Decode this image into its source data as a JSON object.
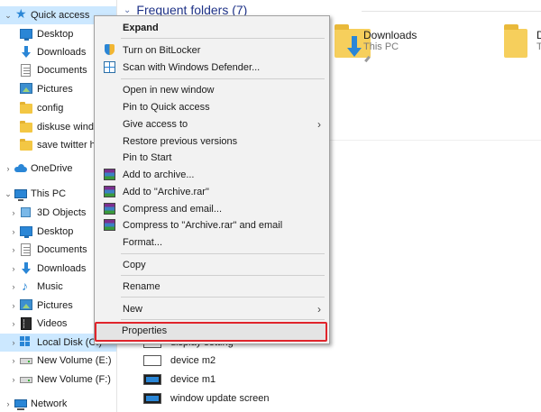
{
  "nav": {
    "quick_access": "Quick access",
    "qa_items": [
      "Desktop",
      "Downloads",
      "Documents",
      "Pictures",
      "config",
      "diskuse windo",
      "save twitter ho"
    ],
    "onedrive": "OneDrive",
    "this_pc": "This PC",
    "pc_items": [
      "3D Objects",
      "Desktop",
      "Documents",
      "Downloads",
      "Music",
      "Pictures",
      "Videos",
      "Local Disk (C:)",
      "New Volume (E:)",
      "New Volume (F:)"
    ],
    "network": "Network",
    "chevron_down": "⌄",
    "chevron_right": "›"
  },
  "main": {
    "section_title": "Frequent folders (7)",
    "tiles": [
      {
        "name": "Downloads",
        "sub": "This PC"
      },
      {
        "name": "D",
        "sub": "T"
      }
    ],
    "files": [
      "display setting",
      "device m2",
      "device m1",
      "window update screen"
    ]
  },
  "context_menu": {
    "items": {
      "expand": "Expand",
      "bitlocker": "Turn on BitLocker",
      "defender": "Scan with Windows Defender...",
      "open_new_window": "Open in new window",
      "pin_quick_access": "Pin to Quick access",
      "give_access": "Give access to",
      "restore_versions": "Restore previous versions",
      "pin_start": "Pin to Start",
      "add_archive": "Add to archive...",
      "add_archive_rar": "Add to \"Archive.rar\"",
      "compress_email": "Compress and email...",
      "compress_rar_email": "Compress to \"Archive.rar\" and email",
      "format": "Format...",
      "copy": "Copy",
      "rename": "Rename",
      "new": "New",
      "properties": "Properties"
    },
    "submenu_arrow": "›"
  },
  "colors": {
    "selection": "#cce8ff",
    "highlight_border": "#e0242b",
    "header_text": "#1e3287"
  }
}
